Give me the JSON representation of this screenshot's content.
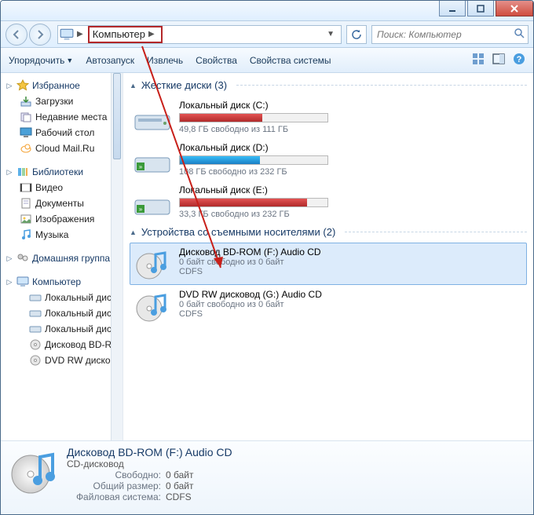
{
  "breadcrumb": {
    "label": "Компьютер"
  },
  "search": {
    "placeholder": "Поиск: Компьютер"
  },
  "toolbar": {
    "organize": "Упорядочить",
    "autoplay": "Автозапуск",
    "eject": "Извлечь",
    "properties": "Свойства",
    "sysprops": "Свойства системы"
  },
  "sidebar": {
    "favorites": {
      "title": "Избранное",
      "items": [
        "Загрузки",
        "Недавние места",
        "Рабочий стол",
        "Cloud Mail.Ru"
      ]
    },
    "libraries": {
      "title": "Библиотеки",
      "items": [
        "Видео",
        "Документы",
        "Изображения",
        "Музыка"
      ]
    },
    "homegroup": {
      "title": "Домашняя группа"
    },
    "computer": {
      "title": "Компьютер",
      "items": [
        "Локальный диск",
        "Локальный диск",
        "Локальный диск",
        "Дисковод BD-RO",
        "DVD RW дисково"
      ]
    }
  },
  "sections": {
    "hdd": {
      "title": "Жесткие диски",
      "count": "(3)"
    },
    "removable": {
      "title": "Устройства со съемными носителями",
      "count": "(2)"
    }
  },
  "drives": {
    "c": {
      "title": "Локальный диск (C:)",
      "sub": "49,8 ГБ свободно из 111 ГБ",
      "fill_pct": 56,
      "fill_class": "red"
    },
    "d": {
      "title": "Локальный диск (D:)",
      "sub": "108 ГБ свободно из 232 ГБ",
      "fill_pct": 54,
      "fill_class": ""
    },
    "e": {
      "title": "Локальный диск (E:)",
      "sub": "33,3 ГБ свободно из 232 ГБ",
      "fill_pct": 86,
      "fill_class": "red"
    },
    "f": {
      "title": "Дисковод BD-ROM (F:) Audio CD",
      "sub": "0 байт свободно из 0 байт",
      "fs": "CDFS"
    },
    "g": {
      "title": "DVD RW дисковод (G:) Audio CD",
      "sub": "0 байт свободно из 0 байт",
      "fs": "CDFS"
    }
  },
  "details": {
    "title": "Дисковод BD-ROM (F:) Audio CD",
    "type": "CD-дисковод",
    "free_label": "Свободно:",
    "free_val": "0 байт",
    "total_label": "Общий размер:",
    "total_val": "0 байт",
    "fs_label": "Файловая система:",
    "fs_val": "CDFS"
  }
}
